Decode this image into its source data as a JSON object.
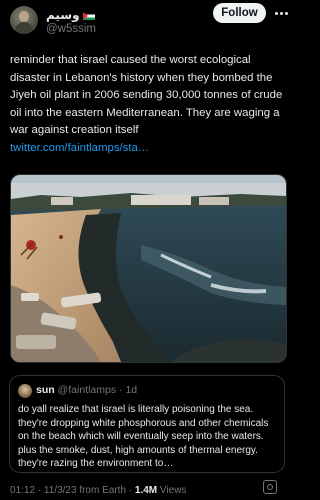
{
  "author": {
    "display_name": "وسيم",
    "handle": "@w5ssim"
  },
  "header": {
    "follow_label": "Follow"
  },
  "tweet": {
    "text": "reminder that israel caused the worst ecological disaster in Lebanon's history when they bombed the Jiyeh oil plant in 2006 sending 30,000 tonnes of crude oil into the eastern Mediterranean. They are waging a war against creation itself",
    "link": "twitter.com/faintlamps/sta…"
  },
  "quote": {
    "name": "sun",
    "handle": "@faintlamps",
    "time": "1d",
    "text": "do yall realize that israel is literally poisoning the sea. they're dropping white phosphorous and other chemicals on the beach which will eventually seep into the waters. plus the smoke, dust, high amounts of thermal energy. they're razing the environment to…"
  },
  "footer": {
    "time": "01:12",
    "date": "11/3/23",
    "source": "from Earth",
    "views_count": "1.4M",
    "views_label": "Views"
  },
  "colors": {
    "background": "#000000",
    "text": "#e7e9ea",
    "muted": "#71767b",
    "link": "#1d9bf0",
    "border": "#2f3336"
  },
  "icons": [
    "more-icon",
    "flag-icon",
    "grok-icon"
  ]
}
